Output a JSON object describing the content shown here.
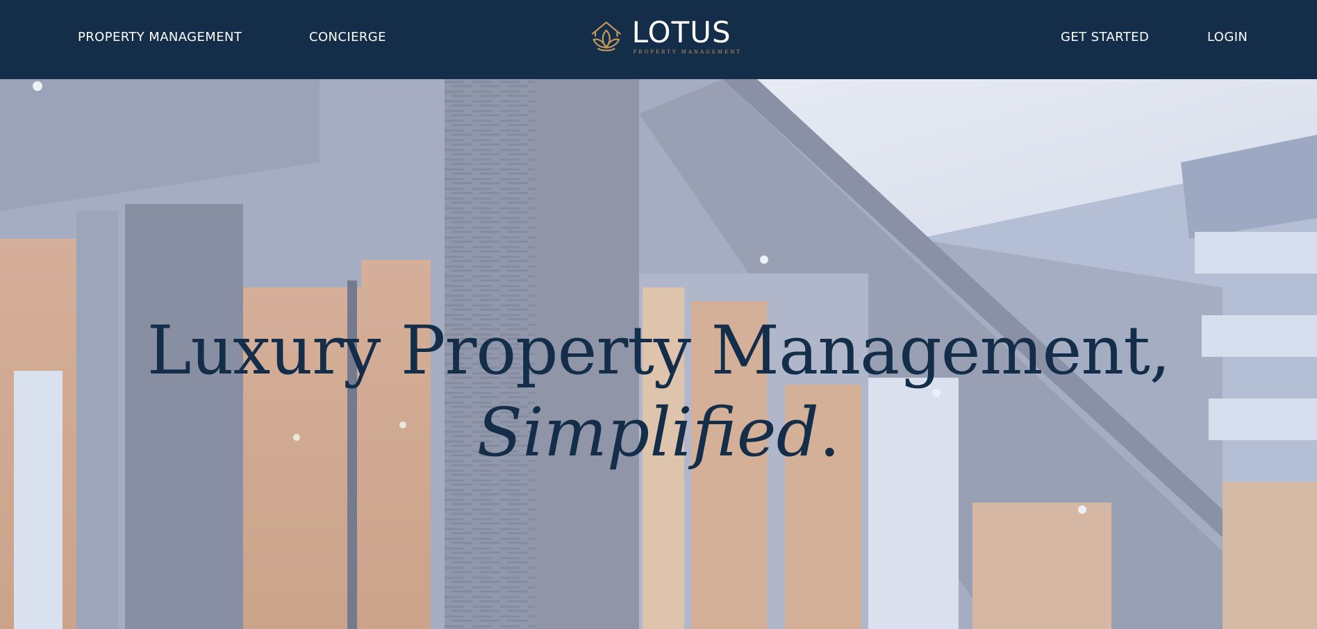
{
  "nav": {
    "left": [
      {
        "label": "PROPERTY MANAGEMENT"
      },
      {
        "label": "CONCIERGE"
      }
    ],
    "right": [
      {
        "label": "GET STARTED"
      },
      {
        "label": "LOGIN"
      }
    ]
  },
  "logo": {
    "word": "LOTUS",
    "tagline": "PROPERTY MANAGEMENT",
    "icon": "lotus-house-icon"
  },
  "hero": {
    "line1": "Luxury Property Management,",
    "line2_italic": "Simplified",
    "line2_end": "."
  },
  "colors": {
    "navy": "#142e4a",
    "gold": "#c79a5b",
    "white": "#ffffff"
  }
}
